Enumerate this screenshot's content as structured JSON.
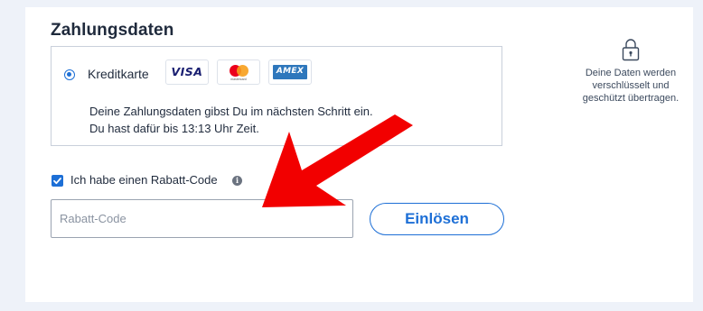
{
  "section": {
    "title": "Zahlungsdaten"
  },
  "payment": {
    "option_label": "Kreditkarte",
    "cards": {
      "visa": "VISA",
      "mastercard": "mastercard",
      "amex": "AMEX"
    },
    "info_line1": "Deine Zahlungsdaten gibst Du im nächsten Schritt ein.",
    "info_line2": "Du hast dafür bis 13:13 Uhr Zeit."
  },
  "security": {
    "line1": "Deine Daten werden",
    "line2": "verschlüsselt und",
    "line3": "geschützt übertragen."
  },
  "discount": {
    "checkbox_label": "Ich habe einen Rabatt-Code",
    "checked": true,
    "input_placeholder": "Rabatt-Code",
    "input_value": "",
    "redeem_label": "Einlösen"
  },
  "colors": {
    "accent": "#1d6fd6",
    "annotation_arrow": "#f20000",
    "background": "#eef2f9"
  },
  "icons": [
    "radio-selected",
    "visa-logo",
    "mastercard-logo",
    "amex-logo",
    "lock-icon",
    "checkbox-checked",
    "info-icon",
    "red-arrow"
  ]
}
